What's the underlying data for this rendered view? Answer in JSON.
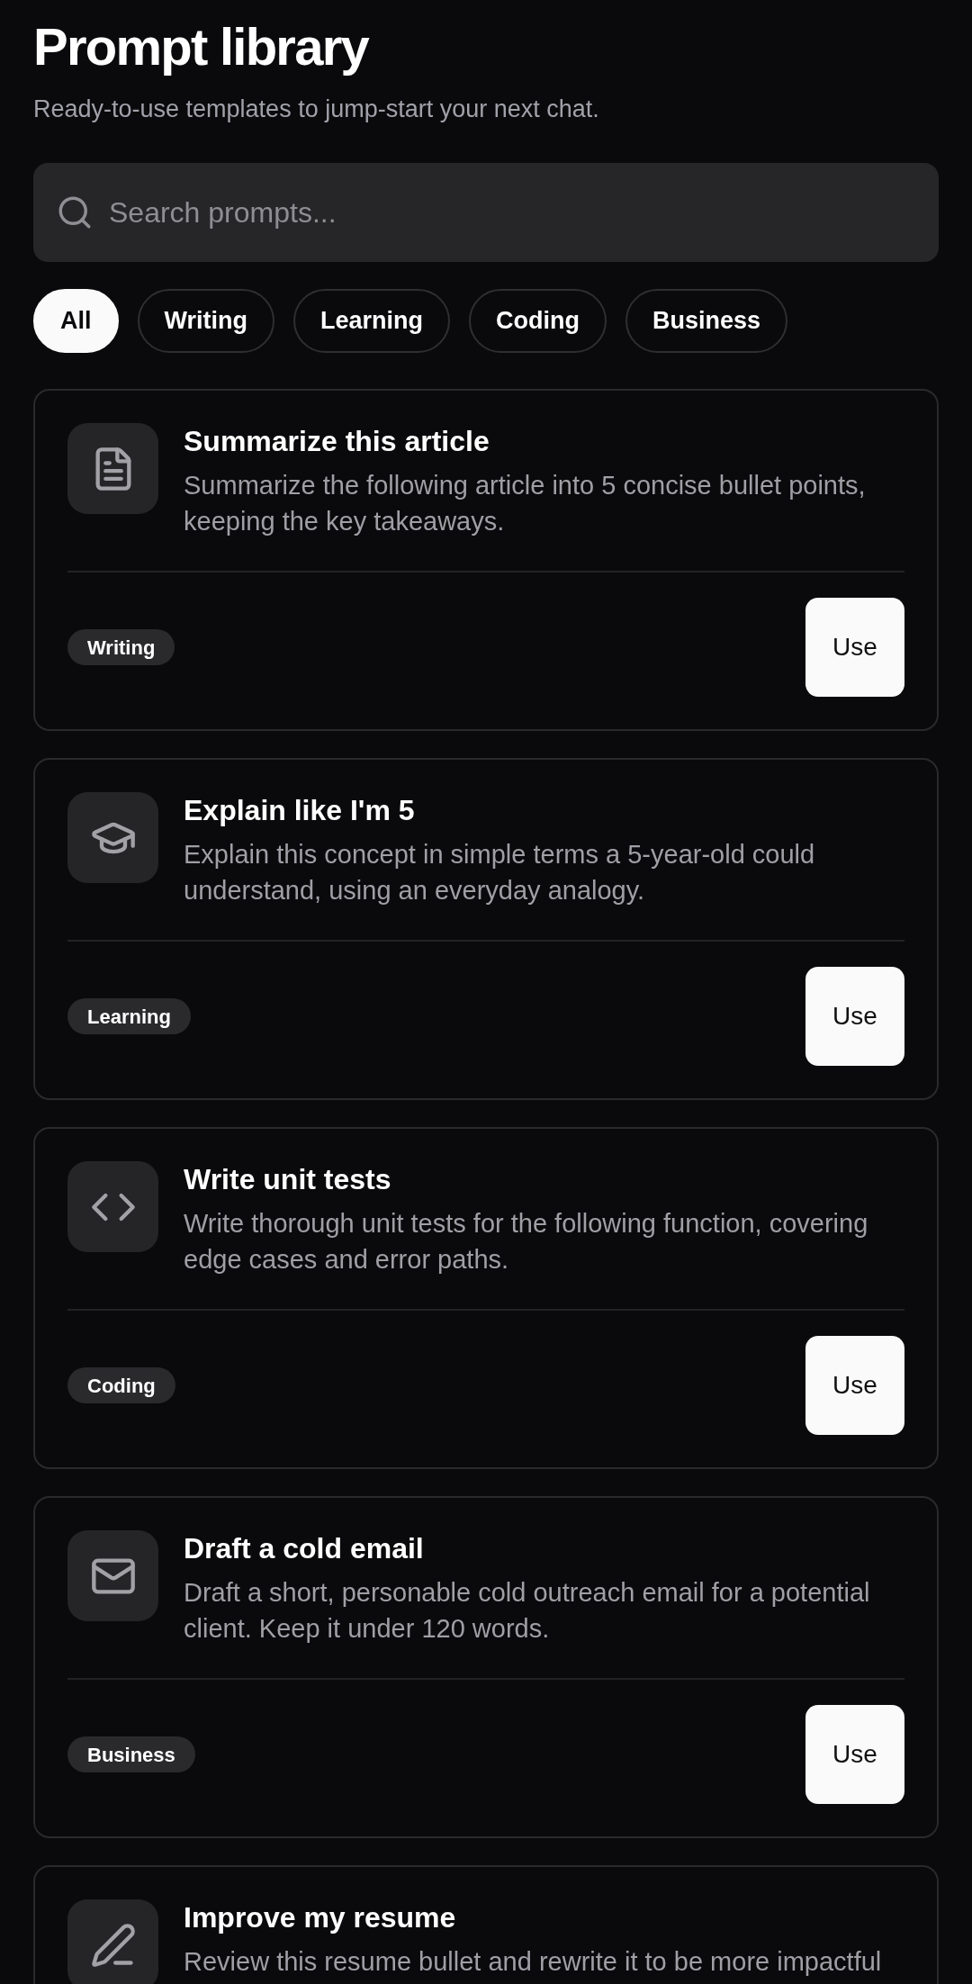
{
  "header": {
    "title": "Prompt library",
    "subtitle": "Ready-to-use templates to jump-start your next chat."
  },
  "search": {
    "placeholder": "Search prompts..."
  },
  "filters": [
    {
      "label": "All",
      "selected": true
    },
    {
      "label": "Writing",
      "selected": false
    },
    {
      "label": "Learning",
      "selected": false
    },
    {
      "label": "Coding",
      "selected": false
    },
    {
      "label": "Business",
      "selected": false
    }
  ],
  "prompts": [
    {
      "title": "Summarize this article",
      "description": "Summarize the following article into 5 concise bullet points, keeping the key takeaways.",
      "tag": "Writing",
      "action": "Use"
    },
    {
      "title": "Explain like I'm 5",
      "description": "Explain this concept in simple terms a 5-year-old could understand, using an everyday analogy.",
      "tag": "Learning",
      "action": "Use"
    },
    {
      "title": "Write unit tests",
      "description": "Write thorough unit tests for the following function, covering edge cases and error paths.",
      "tag": "Coding",
      "action": "Use"
    },
    {
      "title": "Draft a cold email",
      "description": "Draft a short, personable cold outreach email for a potential client. Keep it under 120 words.",
      "tag": "Business",
      "action": "Use"
    },
    {
      "title": "Improve my resume",
      "description": "Review this resume bullet and rewrite it to be more impactful"
    }
  ]
}
